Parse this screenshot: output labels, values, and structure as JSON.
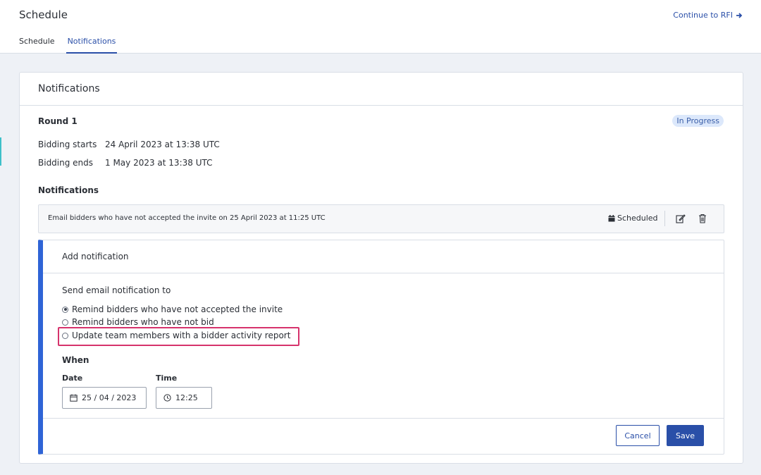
{
  "header": {
    "title": "Schedule",
    "continue_label": "Continue to RFI",
    "tabs": [
      {
        "label": "Schedule",
        "active": false
      },
      {
        "label": "Notifications",
        "active": true
      }
    ]
  },
  "card": {
    "title": "Notifications",
    "round": {
      "title": "Round 1",
      "status": "In Progress",
      "bidding_starts_label": "Bidding starts",
      "bidding_starts_value": "24 April 2023 at 13:38 UTC",
      "bidding_ends_label": "Bidding ends",
      "bidding_ends_value": "1 May 2023 at 13:38 UTC"
    },
    "notifications_heading": "Notifications",
    "existing_notification": {
      "text": "Email bidders who have not accepted the invite on 25 April 2023 at 11:25 UTC",
      "status": "Scheduled"
    },
    "add_notification": {
      "title": "Add notification",
      "send_label": "Send email notification to",
      "options": [
        {
          "label": "Remind bidders who have not accepted the invite",
          "checked": true
        },
        {
          "label": "Remind bidders who have not bid",
          "checked": false
        },
        {
          "label": "Update team members with a bidder activity report",
          "checked": false
        }
      ],
      "when_label": "When",
      "date_label": "Date",
      "date_value": "25 / 04 / 2023",
      "time_label": "Time",
      "time_value": "12:25",
      "cancel_label": "Cancel",
      "save_label": "Save"
    }
  },
  "colors": {
    "primary": "#2a4fa8",
    "accent_bar": "#2f64d6",
    "badge_bg": "#dce8fb",
    "highlight": "#d6336c"
  },
  "icons": {
    "continue": "arrow-right-icon",
    "scheduled": "calendar-icon",
    "edit": "edit-icon",
    "delete": "trash-icon",
    "date": "calendar-icon",
    "time": "clock-icon"
  }
}
